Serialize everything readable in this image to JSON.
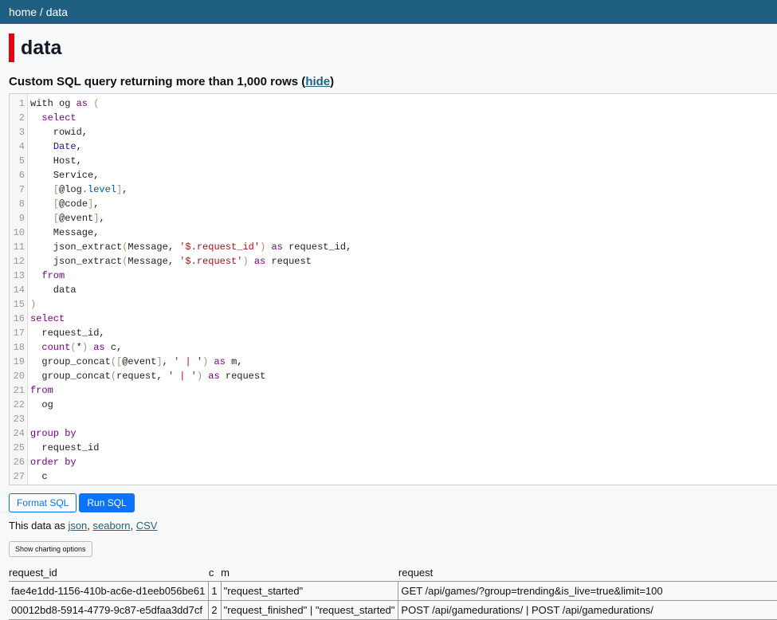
{
  "header": {
    "breadcrumb": "home / data"
  },
  "page": {
    "title": "data",
    "subtitle": "Custom SQL query returning more than 1,000 rows",
    "subtitle_open": " (",
    "subtitle_close": ")",
    "hide_label": "hide"
  },
  "editor": {
    "lines": [
      [
        {
          "t": "with og ",
          "c": ""
        },
        {
          "t": "as",
          "c": "kw"
        },
        {
          "t": " (",
          "c": "br"
        }
      ],
      [
        {
          "t": "  ",
          "c": ""
        },
        {
          "t": "select",
          "c": "kw"
        }
      ],
      [
        {
          "t": "    rowid,",
          "c": ""
        }
      ],
      [
        {
          "t": "    ",
          "c": ""
        },
        {
          "t": "Date",
          "c": "def"
        },
        {
          "t": ",",
          "c": ""
        }
      ],
      [
        {
          "t": "    Host,",
          "c": ""
        }
      ],
      [
        {
          "t": "    Service,",
          "c": ""
        }
      ],
      [
        {
          "t": "    ",
          "c": ""
        },
        {
          "t": "[",
          "c": "br"
        },
        {
          "t": "@log",
          "c": ""
        },
        {
          "t": ".level",
          "c": "prop"
        },
        {
          "t": "]",
          "c": "br"
        },
        {
          "t": ",",
          "c": ""
        }
      ],
      [
        {
          "t": "    ",
          "c": ""
        },
        {
          "t": "[",
          "c": "br"
        },
        {
          "t": "@code",
          "c": ""
        },
        {
          "t": "]",
          "c": "br"
        },
        {
          "t": ",",
          "c": ""
        }
      ],
      [
        {
          "t": "    ",
          "c": ""
        },
        {
          "t": "[",
          "c": "br"
        },
        {
          "t": "@event",
          "c": ""
        },
        {
          "t": "]",
          "c": "br"
        },
        {
          "t": ",",
          "c": ""
        }
      ],
      [
        {
          "t": "    Message,",
          "c": ""
        }
      ],
      [
        {
          "t": "    json_extract",
          "c": ""
        },
        {
          "t": "(",
          "c": "br"
        },
        {
          "t": "Message, ",
          "c": ""
        },
        {
          "t": "'$.request_id'",
          "c": "str"
        },
        {
          "t": ")",
          "c": "br"
        },
        {
          "t": " ",
          "c": ""
        },
        {
          "t": "as",
          "c": "kw"
        },
        {
          "t": " request_id,",
          "c": ""
        }
      ],
      [
        {
          "t": "    json_extract",
          "c": ""
        },
        {
          "t": "(",
          "c": "br"
        },
        {
          "t": "Message, ",
          "c": ""
        },
        {
          "t": "'$.request'",
          "c": "str"
        },
        {
          "t": ")",
          "c": "br"
        },
        {
          "t": " ",
          "c": ""
        },
        {
          "t": "as",
          "c": "kw"
        },
        {
          "t": " request",
          "c": ""
        }
      ],
      [
        {
          "t": "  ",
          "c": ""
        },
        {
          "t": "from",
          "c": "kw"
        }
      ],
      [
        {
          "t": "    data",
          "c": ""
        }
      ],
      [
        {
          "t": ")",
          "c": "br"
        }
      ],
      [
        {
          "t": "select",
          "c": "kw"
        }
      ],
      [
        {
          "t": "  request_id,",
          "c": ""
        }
      ],
      [
        {
          "t": "  ",
          "c": ""
        },
        {
          "t": "count",
          "c": "kw"
        },
        {
          "t": "(",
          "c": "br"
        },
        {
          "t": "*",
          "c": ""
        },
        {
          "t": ")",
          "c": "br"
        },
        {
          "t": " ",
          "c": ""
        },
        {
          "t": "as",
          "c": "kw"
        },
        {
          "t": " c,",
          "c": ""
        }
      ],
      [
        {
          "t": "  group_concat",
          "c": ""
        },
        {
          "t": "([",
          "c": "br"
        },
        {
          "t": "@event",
          "c": ""
        },
        {
          "t": "]",
          "c": "br"
        },
        {
          "t": ", ",
          "c": ""
        },
        {
          "t": "' | '",
          "c": "str"
        },
        {
          "t": ")",
          "c": "br"
        },
        {
          "t": " ",
          "c": ""
        },
        {
          "t": "as",
          "c": "kw"
        },
        {
          "t": " m,",
          "c": ""
        }
      ],
      [
        {
          "t": "  group_concat",
          "c": ""
        },
        {
          "t": "(",
          "c": "br"
        },
        {
          "t": "request, ",
          "c": ""
        },
        {
          "t": "' | '",
          "c": "str"
        },
        {
          "t": ")",
          "c": "br"
        },
        {
          "t": " ",
          "c": ""
        },
        {
          "t": "as",
          "c": "kw"
        },
        {
          "t": " request",
          "c": ""
        }
      ],
      [
        {
          "t": "from",
          "c": "kw"
        }
      ],
      [
        {
          "t": "  og",
          "c": ""
        }
      ],
      [
        {
          "t": "",
          "c": ""
        }
      ],
      [
        {
          "t": "group by",
          "c": "kw"
        }
      ],
      [
        {
          "t": "  request_id",
          "c": ""
        }
      ],
      [
        {
          "t": "order by",
          "c": "kw"
        }
      ],
      [
        {
          "t": "  c",
          "c": ""
        }
      ]
    ]
  },
  "buttons": {
    "format_sql": "Format SQL",
    "run_sql": "Run SQL"
  },
  "export": {
    "prefix": "This data as ",
    "json": "json",
    "seaborn": "seaborn",
    "csv": "CSV",
    "sep": ", "
  },
  "charting": {
    "label": "Show charting options"
  },
  "table": {
    "columns": [
      "request_id",
      "c",
      "m",
      "request"
    ],
    "rows": [
      [
        "fae4e1dd-1156-410b-ac6e-d1eeb056be61",
        "1",
        "\"request_started\"",
        "GET /api/games/?group=trending&is_live=true&limit=100"
      ],
      [
        "00012bd8-5914-4779-9c87-e5dfaa3dd7cf",
        "2",
        "\"request_finished\" | \"request_started\"",
        "POST /api/gamedurations/ | POST /api/gamedurations/"
      ]
    ]
  },
  "colors": {
    "header_bg": "#1f5f82",
    "title_accent": "#e60012",
    "primary_button": "#0a74ff"
  }
}
